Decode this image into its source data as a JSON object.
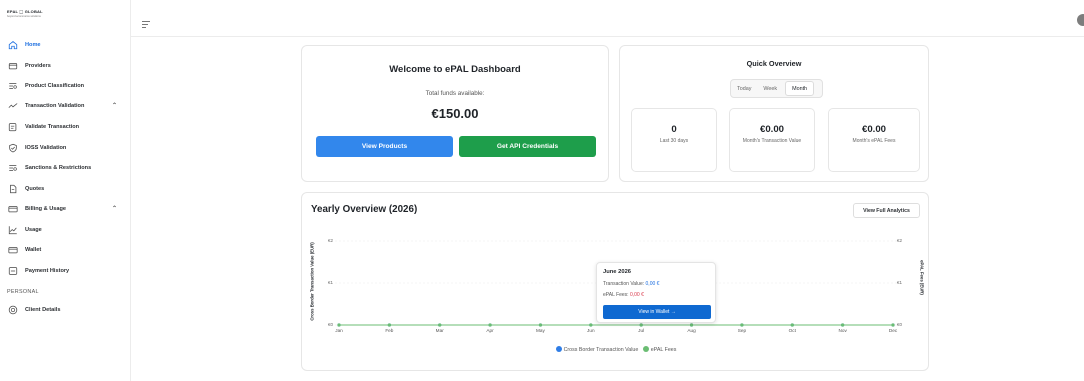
{
  "logo": {
    "line1": "EPAL ⬚ GLOBAL",
    "line2": "beyond ecommerce solutions"
  },
  "sidebar": {
    "items": [
      {
        "label": "Home",
        "icon": "home-icon",
        "active": true
      },
      {
        "label": "Providers",
        "icon": "card-icon"
      },
      {
        "label": "Product Classification",
        "icon": "list-search-icon"
      },
      {
        "label": "Transaction Validation",
        "icon": "activity-icon",
        "chevron": "⌃"
      },
      {
        "label": "Validate Transaction",
        "icon": "clipboard-icon"
      },
      {
        "label": "IOSS Validation",
        "icon": "shield-check-icon"
      },
      {
        "label": "Sanctions & Restrictions",
        "icon": "list-search-icon"
      },
      {
        "label": "Quotes",
        "icon": "file-icon"
      },
      {
        "label": "Billing & Usage",
        "icon": "wallet-icon",
        "chevron": "⌃"
      },
      {
        "label": "Usage",
        "icon": "chart-line-icon"
      },
      {
        "label": "Wallet",
        "icon": "wallet-icon"
      },
      {
        "label": "Payment History",
        "icon": "receipt-icon"
      }
    ],
    "section_label": "PERSONAL",
    "personal_items": [
      {
        "label": "Client Details",
        "icon": "user-circle-icon"
      }
    ]
  },
  "welcome": {
    "title": "Welcome to ePAL Dashboard",
    "funds_label": "Total funds available:",
    "funds_value": "€150.00",
    "view_products": "View Products",
    "api_credentials": "Get API Credentials"
  },
  "quick": {
    "title": "Quick Overview",
    "tabs": [
      "Today",
      "Week",
      "Month"
    ],
    "selected_tab": "Month",
    "stats": [
      {
        "value": "0",
        "label": "Last 30 days"
      },
      {
        "value": "€0.00",
        "label": "Month's Transaction Value"
      },
      {
        "value": "€0.00",
        "label": "Month's ePAL Fees"
      }
    ]
  },
  "yearly": {
    "title": "Yearly Overview (2026)",
    "analytics_button": "View Full Analytics",
    "tooltip": {
      "title": "June 2026",
      "tx_label": "Transaction Value:",
      "tx_value": "0,00 €",
      "fees_label": "ePAL Fees:",
      "fees_value": "0,00 €",
      "wallet_button": "View in Wallet →"
    }
  },
  "chart_data": {
    "type": "line",
    "categories": [
      "Jan",
      "Feb",
      "Mar",
      "Apr",
      "May",
      "Jun",
      "Jul",
      "Aug",
      "Sep",
      "Oct",
      "Nov",
      "Dec"
    ],
    "series": [
      {
        "name": "Cross Border Transaction Value",
        "values": [
          0,
          0,
          0,
          0,
          0,
          0,
          0,
          0,
          0,
          0,
          0,
          0
        ],
        "color": "#2f7de6"
      },
      {
        "name": "ePAL Fees",
        "values": [
          0,
          0,
          0,
          0,
          0,
          0,
          0,
          0,
          0,
          0,
          0,
          0
        ],
        "color": "#6bbd73"
      }
    ],
    "ylabel": "Cross Border Transaction Value (EUR)",
    "ylabel_right": "ePAL Fees (EUR)",
    "yticks_left": [
      "€2",
      "€1",
      "€0"
    ],
    "yticks_right": [
      "€2",
      "€1",
      "€0"
    ],
    "ylim": [
      0,
      2
    ],
    "grid": true,
    "legend_position": "bottom"
  },
  "colors": {
    "accent": "#1d6fe0",
    "primary_button": "#3287ec",
    "success_button": "#1e9e4b"
  }
}
